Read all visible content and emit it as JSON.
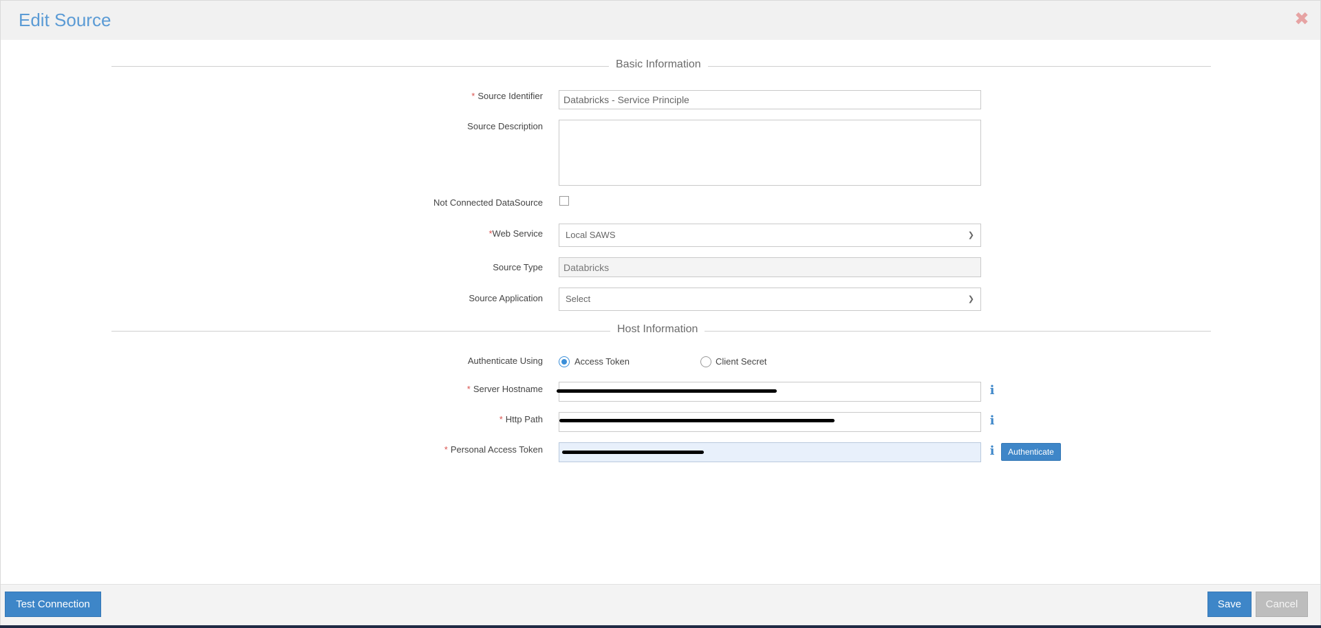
{
  "dialog": {
    "title": "Edit Source",
    "close_icon": "close-x-icon"
  },
  "sections": {
    "basic": "Basic Information",
    "host": "Host Information"
  },
  "fields": {
    "source_identifier": {
      "label": "Source Identifier",
      "value": "Databricks - Service Principle",
      "required": true
    },
    "source_description": {
      "label": "Source Description",
      "value": ""
    },
    "not_connected": {
      "label": "Not Connected DataSource",
      "checked": false
    },
    "web_service": {
      "label": "Web Service",
      "selected": "Local SAWS",
      "required": true
    },
    "source_type": {
      "label": "Source Type",
      "value": "Databricks"
    },
    "source_application": {
      "label": "Source Application",
      "selected": "Select"
    },
    "authenticate_using": {
      "label": "Authenticate Using",
      "options": [
        "Access Token",
        "Client Secret"
      ],
      "selected": "Access Token"
    },
    "server_hostname": {
      "label": "Server Hostname",
      "required": true
    },
    "http_path": {
      "label": "Http Path",
      "required": true
    },
    "personal_access_token": {
      "label": "Personal Access Token",
      "required": true
    }
  },
  "buttons": {
    "authenticate": "Authenticate",
    "test_connection": "Test Connection",
    "save": "Save",
    "cancel": "Cancel"
  },
  "colors": {
    "accent": "#3e86c8",
    "title": "#5b9bd5",
    "required": "#d9534f"
  }
}
